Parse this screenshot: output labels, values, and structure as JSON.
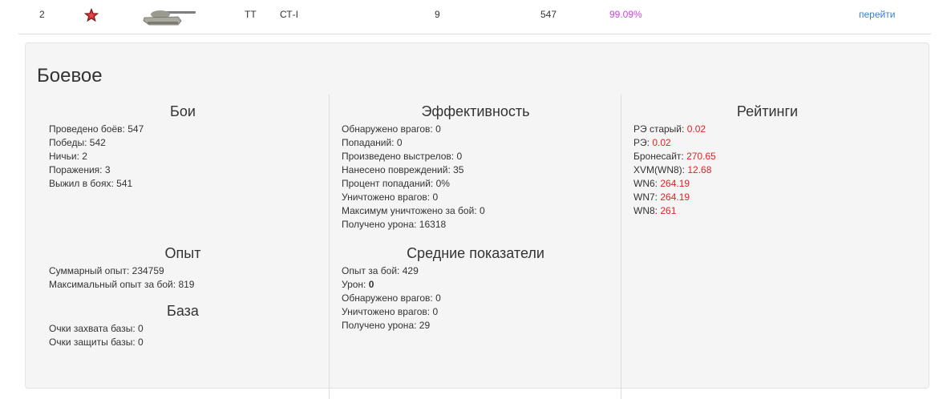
{
  "vehicle_row": {
    "number": "2",
    "type": "ТТ",
    "name": "СТ-I",
    "level": "9",
    "battles": "547",
    "win_percent": "99.09%",
    "link": "перейти",
    "icons": {
      "star": "red-star-icon",
      "tank": "tank-icon"
    }
  },
  "panel": {
    "title": "Боевое",
    "battles": {
      "heading": "Бои",
      "items": [
        {
          "label": "Проведено боёв:",
          "value": "547"
        },
        {
          "label": "Победы:",
          "value": "542"
        },
        {
          "label": "Ничьи:",
          "value": "2"
        },
        {
          "label": "Поражения:",
          "value": "3"
        },
        {
          "label": "Выжил в боях:",
          "value": "541"
        }
      ]
    },
    "experience": {
      "heading": "Опыт",
      "items": [
        {
          "label": "Суммарный опыт:",
          "value": "234759"
        },
        {
          "label": "Максимальный опыт за бой:",
          "value": "819"
        }
      ]
    },
    "base": {
      "heading": "База",
      "items": [
        {
          "label": "Очки захвата базы:",
          "value": "0"
        },
        {
          "label": "Очки защиты базы:",
          "value": "0"
        }
      ]
    },
    "efficiency": {
      "heading": "Эффективность",
      "items": [
        {
          "label": "Обнаружено врагов:",
          "value": "0"
        },
        {
          "label": "Попаданий:",
          "value": "0"
        },
        {
          "label": "Произведено выстрелов:",
          "value": "0"
        },
        {
          "label": "Нанесено повреждений:",
          "value": "35"
        },
        {
          "label": "Процент попаданий:",
          "value": "0%"
        },
        {
          "label": "Уничтожено врагов:",
          "value": "0"
        },
        {
          "label": "Максимум уничтожено за бой:",
          "value": "0"
        },
        {
          "label": "Получено урона:",
          "value": "16318"
        }
      ]
    },
    "averages": {
      "heading": "Средние показатели",
      "items": [
        {
          "label": "Опыт за бой:",
          "value": "429"
        },
        {
          "label": "Урон:",
          "value": "0"
        },
        {
          "label": "Обнаружено врагов:",
          "value": "0"
        },
        {
          "label": "Уничтожено врагов:",
          "value": "0"
        },
        {
          "label": "Получено урона:",
          "value": "29"
        }
      ]
    },
    "ratings": {
      "heading": "Рейтинги",
      "items": [
        {
          "label": "РЭ старый:",
          "value": "0.02"
        },
        {
          "label": "РЭ:",
          "value": "0.02"
        },
        {
          "label": "Бронесайт:",
          "value": "270.65"
        },
        {
          "label": "XVM(WN8):",
          "value": "12.68"
        },
        {
          "label": "WN6:",
          "value": "264.19"
        },
        {
          "label": "WN7:",
          "value": "264.19"
        },
        {
          "label": "WN8:",
          "value": "261"
        }
      ]
    }
  }
}
